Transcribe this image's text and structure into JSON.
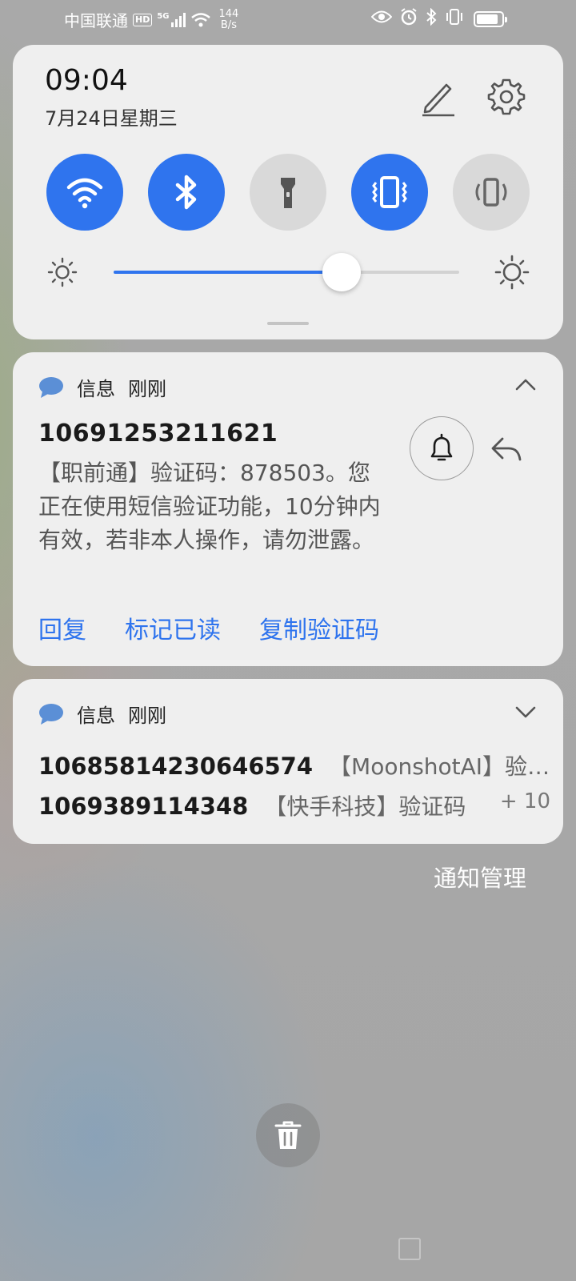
{
  "status_bar": {
    "carrier": "中国联通",
    "hd": "HD",
    "network": "5G",
    "speed_value": "144",
    "speed_unit": "B/s",
    "battery_level": 0.88
  },
  "panel": {
    "time": "09:04",
    "date": "7月24日星期三",
    "tiles": [
      {
        "name": "wifi",
        "icon": "wifi-icon",
        "active": true
      },
      {
        "name": "bluetooth",
        "icon": "bluetooth-icon",
        "active": true
      },
      {
        "name": "flashlight",
        "icon": "flashlight-icon",
        "active": false
      },
      {
        "name": "vibrate",
        "icon": "vibrate-icon",
        "active": true
      },
      {
        "name": "auto-rotate",
        "icon": "rotate-icon",
        "active": false
      }
    ],
    "brightness": 0.66
  },
  "notifications": [
    {
      "app": "信息",
      "time": "刚刚",
      "sender": "10691253211621",
      "body": "【职前通】验证码：878503。您正在使用短信验证功能，10分钟内有效，若非本人操作，请勿泄露。",
      "actions": [
        "回复",
        "标记已读",
        "复制验证码"
      ]
    },
    {
      "app": "信息",
      "time": "刚刚",
      "rows": [
        {
          "number": "10685814230646574",
          "snippet": "【MoonshotAI】验证码",
          "count": ""
        },
        {
          "number": "1069389114348",
          "snippet": "【快手科技】验证码",
          "count": "+ 10"
        }
      ]
    }
  ],
  "notification_management": "通知管理",
  "colors": {
    "accent": "#2f74ee",
    "card": "#efefef"
  }
}
